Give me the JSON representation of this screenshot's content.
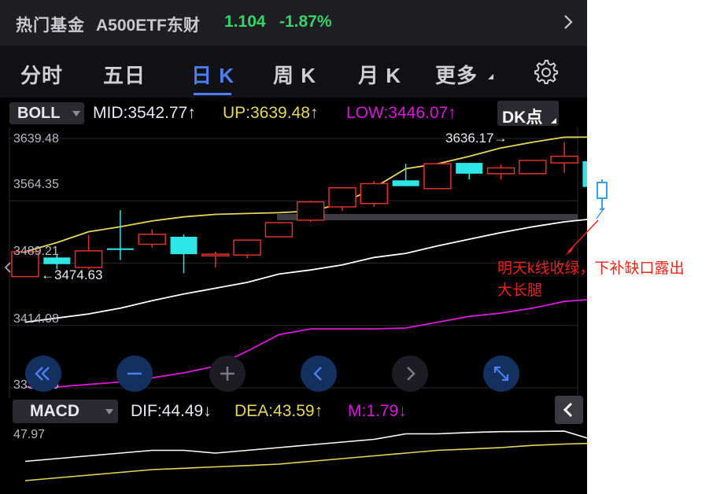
{
  "header": {
    "fund_name": "热门基金",
    "fund_code": "A500ETF东财",
    "price": "1.104",
    "change_pct": "-1.87%",
    "chevron_icon": "chevron-right-icon"
  },
  "tabs": [
    {
      "label": "分时",
      "active": false
    },
    {
      "label": "五日",
      "active": false
    },
    {
      "label": "日 K",
      "active": true
    },
    {
      "label": "周 K",
      "active": false
    },
    {
      "label": "月 K",
      "active": false
    },
    {
      "label": "更多",
      "active": false
    }
  ],
  "settings_icon": "gear-icon",
  "boll": {
    "selector": "BOLL",
    "mid": "MID:3542.77↑",
    "up": "UP:3639.48↑",
    "low": "LOW:3446.07↑",
    "dk_label": "DK点"
  },
  "axis": {
    "y_labels": [
      "3639.48",
      "3564.35",
      "3489.21",
      "3414.08",
      "3338.95"
    ]
  },
  "annotations": {
    "high": "3636.17→",
    "low": "←3474.63"
  },
  "nav_icons": [
    "fast-rewind-icon",
    "zoom-out-icon",
    "zoom-in-icon",
    "step-left-icon",
    "step-right-icon",
    "fullscreen-icon"
  ],
  "macd": {
    "selector": "MACD",
    "dif": "DIF:44.49↓",
    "dea": "DEA:43.59↑",
    "m": "M:1.79↓",
    "y_label": "47.97"
  },
  "note": {
    "line1": "明天k线收绿，下补缺口露出",
    "line2": "大长腿"
  },
  "colors": {
    "up_candle": "#e0312b",
    "down_candle": "#2ee6e6",
    "boll_up": "#e5d85a",
    "boll_mid": "#ffffff",
    "boll_low": "#d81ad8",
    "price_green": "#35d46a",
    "accent_blue": "#4a7ff5",
    "note_red": "#e8241b"
  },
  "chart_data": {
    "type": "candlestick",
    "y_range": [
      3338.95,
      3639.48
    ],
    "y_ticks": [
      3639.48,
      3564.35,
      3489.21,
      3414.08,
      3338.95
    ],
    "candles": [
      {
        "open": 3473,
        "close": 3503,
        "high": 3505,
        "low": 3474
      },
      {
        "open": 3496,
        "close": 3488,
        "high": 3500,
        "low": 3482
      },
      {
        "open": 3484,
        "close": 3504,
        "high": 3523,
        "low": 3482
      },
      {
        "open": 3507,
        "close": 3506,
        "high": 3553,
        "low": 3493
      },
      {
        "open": 3512,
        "close": 3524,
        "high": 3530,
        "low": 3508
      },
      {
        "open": 3521,
        "close": 3500,
        "high": 3524,
        "low": 3477
      },
      {
        "open": 3498,
        "close": 3500,
        "high": 3503,
        "low": 3484
      },
      {
        "open": 3499,
        "close": 3517,
        "high": 3517,
        "low": 3495
      },
      {
        "open": 3521,
        "close": 3538,
        "high": 3539,
        "low": 3521
      },
      {
        "open": 3541,
        "close": 3563,
        "high": 3564,
        "low": 3539
      },
      {
        "open": 3557,
        "close": 3580,
        "high": 3580,
        "low": 3552
      },
      {
        "open": 3561,
        "close": 3585,
        "high": 3588,
        "low": 3557
      },
      {
        "open": 3589,
        "close": 3582,
        "high": 3609,
        "low": 3582
      },
      {
        "open": 3579,
        "close": 3609,
        "high": 3609,
        "low": 3579
      },
      {
        "open": 3610,
        "close": 3597,
        "high": 3610,
        "low": 3590
      },
      {
        "open": 3597,
        "close": 3604,
        "high": 3608,
        "low": 3590
      },
      {
        "open": 3597,
        "close": 3613,
        "high": 3613,
        "low": 3597
      },
      {
        "open": 3610,
        "close": 3618,
        "high": 3635,
        "low": 3598
      },
      {
        "open": 3612,
        "close": 3581,
        "high": 3612,
        "low": 3570
      }
    ],
    "boll_up": [
      3503,
      3514,
      3527,
      3533,
      3540,
      3545,
      3548,
      3549,
      3550,
      3552,
      3561,
      3580,
      3603,
      3609,
      3618,
      3628,
      3635,
      3641,
      3641
    ],
    "boll_mid": [
      3418,
      3423,
      3428,
      3435,
      3444,
      3452,
      3459,
      3466,
      3476,
      3481,
      3487,
      3496,
      3501,
      3510,
      3518,
      3526,
      3533,
      3539,
      3543
    ],
    "boll_low": [
      3340,
      3340,
      3343,
      3346,
      3351,
      3357,
      3365,
      3383,
      3403,
      3410,
      3410,
      3410,
      3411,
      3418,
      3425,
      3429,
      3435,
      3443,
      3446
    ],
    "macd": {
      "dif": [
        37,
        38,
        39,
        40,
        41,
        41,
        40,
        41,
        42,
        43,
        44,
        45,
        47,
        47,
        47.5,
        47.8,
        47.9,
        47.97,
        44.49
      ],
      "dea": [
        30,
        31,
        32,
        33,
        34,
        34.5,
        35,
        35.5,
        36,
        37,
        38,
        39,
        40,
        41,
        41.5,
        42,
        42.8,
        43.3,
        43.59
      ]
    }
  }
}
